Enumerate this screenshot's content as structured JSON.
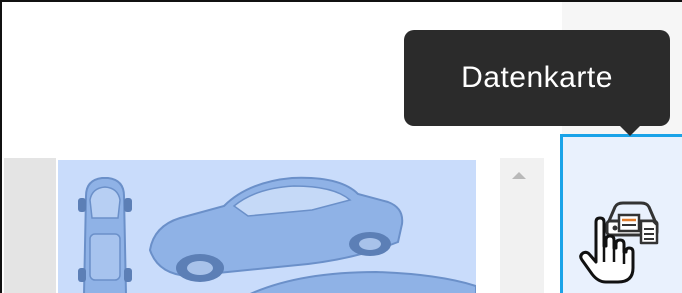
{
  "tooltip": {
    "text": "Datenkarte"
  },
  "toolbar": {
    "active_item": "datacard-button",
    "icon": "vehicle-datacard-icon"
  },
  "colors": {
    "highlight_border": "#1aa3e8",
    "button_bg": "#e9f1fd",
    "tooltip_bg": "#2b2b2b",
    "tooltip_text": "#ffffff",
    "vehicle_image_bg": "#c9dcfb",
    "vehicle_fill": "#8fb2e6",
    "vehicle_stroke": "#6b90c9"
  }
}
